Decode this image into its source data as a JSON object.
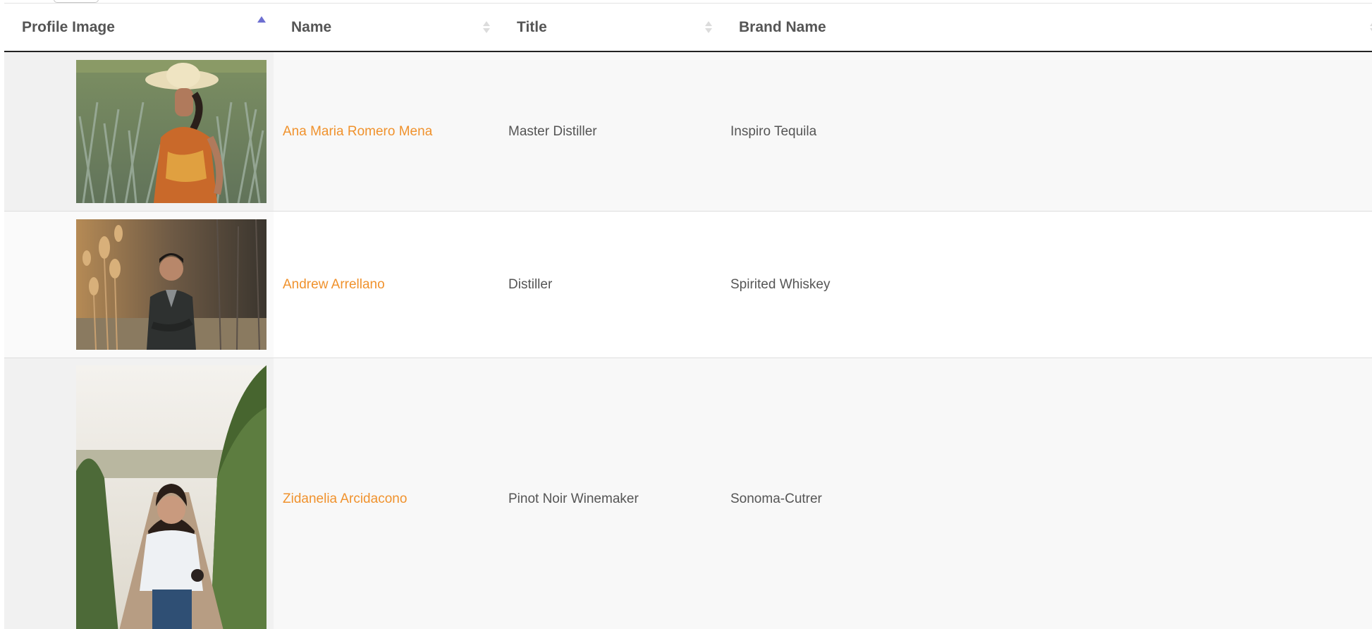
{
  "table": {
    "columns": [
      {
        "label": "Profile Image",
        "sort": "ascending"
      },
      {
        "label": "Name",
        "sort": "none"
      },
      {
        "label": "Title",
        "sort": "none"
      },
      {
        "label": "Brand Name",
        "sort": "none"
      }
    ],
    "rows": [
      {
        "image": "photo of woman in straw hat in agave field",
        "name": "Ana Maria Romero Mena",
        "title": "Master Distiller",
        "brand": "Inspiro Tequila"
      },
      {
        "image": "photo of smiling man in dark jacket among dried thistles",
        "name": "Andrew Arrellano",
        "title": "Distiller",
        "brand": "Spirited Whiskey"
      },
      {
        "image": "photo of woman in white top standing between vineyard rows",
        "name": "Zidanelia Arcidacono",
        "title": "Pinot Noir Winemaker",
        "brand": "Sonoma-Cutrer"
      }
    ]
  },
  "colors": {
    "link": "#f0922d",
    "sort_active": "#6d6fd1",
    "header_text": "#555555",
    "header_rule": "#222222"
  }
}
